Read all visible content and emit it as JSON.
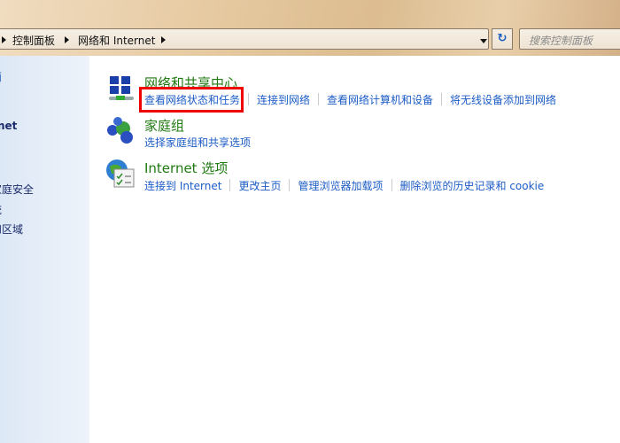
{
  "address_bar": {
    "breadcrumbs": [
      "控制面板",
      "网络和 Internet"
    ]
  },
  "search": {
    "placeholder": "搜索控制面板"
  },
  "sidebar": {
    "items": [
      "面",
      "net",
      "家庭安全",
      "统",
      "和区域"
    ]
  },
  "categories": [
    {
      "title": "网络和共享中心",
      "icon": "network-sharing-icon",
      "links": [
        "查看网络状态和任务",
        "连接到网络",
        "查看网络计算机和设备",
        "将无线设备添加到网络"
      ]
    },
    {
      "title": "家庭组",
      "icon": "homegroup-icon",
      "links": [
        "选择家庭组和共享选项"
      ]
    },
    {
      "title": "Internet 选项",
      "icon": "internet-options-icon",
      "links": [
        "连接到 Internet",
        "更改主页",
        "管理浏览器加载项",
        "删除浏览的历史记录和 cookie"
      ]
    }
  ],
  "highlight_color": "#e00000"
}
